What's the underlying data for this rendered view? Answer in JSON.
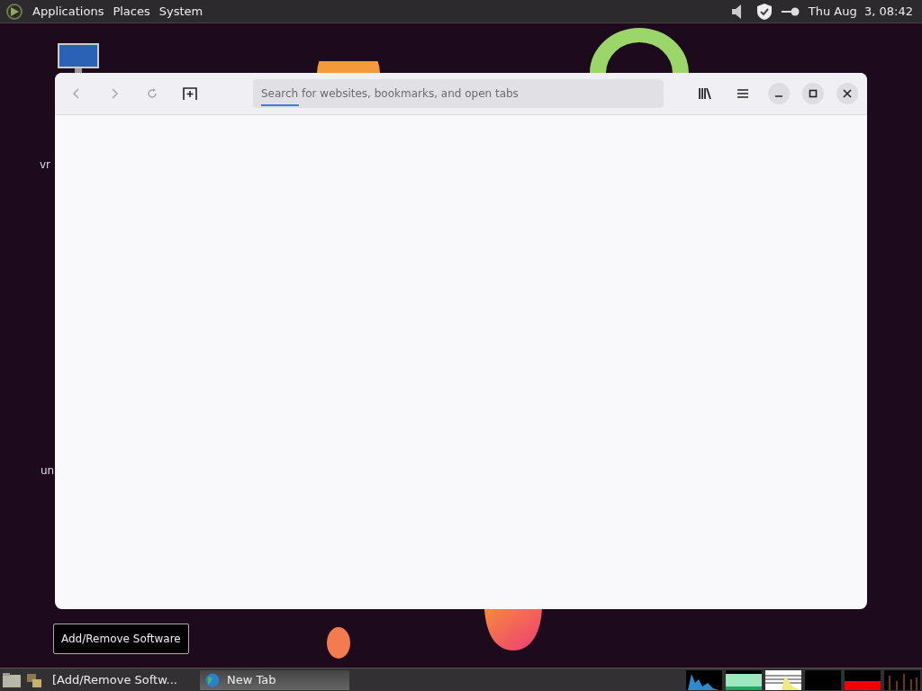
{
  "top_panel": {
    "menus": [
      "Applications",
      "Places",
      "System"
    ],
    "clock": "Thu Aug  3, 08:42"
  },
  "desktop": {
    "icon_labels": [
      "vr",
      "un"
    ]
  },
  "browser": {
    "search": {
      "placeholder": "Search for websites, bookmarks, and open tabs"
    }
  },
  "tooltip": "Add/Remove Software",
  "taskbar": {
    "tasks": [
      {
        "label": "[Add/Remove Softw...",
        "selected": false
      },
      {
        "label": "New Tab",
        "selected": true
      }
    ]
  }
}
